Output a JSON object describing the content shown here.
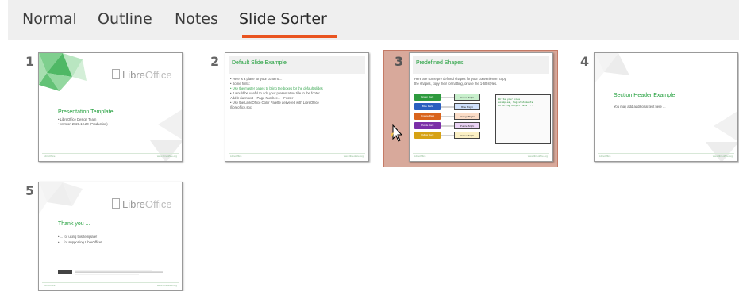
{
  "tabs": [
    {
      "label": "Normal",
      "active": false
    },
    {
      "label": "Outline",
      "active": false
    },
    {
      "label": "Notes",
      "active": false
    },
    {
      "label": "Slide Sorter",
      "active": true
    }
  ],
  "colors": {
    "accent": "#e95420",
    "selection": "#d8a99b",
    "title_green": "#1f9e3a"
  },
  "slides": {
    "s1": {
      "number": "1",
      "logo_main": "Libre",
      "logo_sub": "Office",
      "title": "Presentation Template",
      "bullets": [
        "• LibreOffice Design Team",
        "• Version 2021.10.20 (Production)"
      ],
      "footer_left": "LibreOffice",
      "footer_right": "www.libreoffice.org"
    },
    "s2": {
      "number": "2",
      "title": "Default Slide Example",
      "bullets": [
        "• Here is a place for your content ...",
        "• Some hints:",
        "   • Use the master pages to bring the boxes for the default slides",
        "   • It would be useful to add your presentation title to the footer.",
        "     Add it via  Insert – Page Number... – Footer",
        "   • Use the LibreOffice Color Palette delivered with LibreOffice",
        "     (libreoffice.soc)"
      ],
      "footer_left": "LibreOffice",
      "footer_right": "www.libreoffice.org"
    },
    "s3": {
      "number": "3",
      "title": "Predefined Shapes",
      "intro": [
        "Here are some pre defined shapes for your convenience: copy",
        "the shapes, copy their formatting, or use the 1-60 styles."
      ],
      "shapes_dark": [
        "Green Dark",
        "Blue Dark",
        "Orange Dark",
        "Purple Dark",
        "Yellow Dark"
      ],
      "shapes_bright": [
        "Green Bright",
        "Blue Bright",
        "Orange Bright",
        "Purple Bright",
        "Yellow Bright"
      ],
      "code_text": "Write your code\nexamples, log statements\nor bring output here ...",
      "footer_left": "LibreOffice",
      "footer_right": "www.libreoffice.org"
    },
    "s4": {
      "number": "4",
      "title": "Section Header Example",
      "body": "You may add additional text here ...",
      "footer_left": "LibreOffice",
      "footer_right": "www.libreoffice.org"
    },
    "s5": {
      "number": "5",
      "logo_main": "Libre",
      "logo_sub": "Office",
      "title": "Thank you ...",
      "bullets": [
        "• ... for using this template!",
        "• ... for supporting LibreOffice!"
      ],
      "footer_left": "LibreOffice",
      "footer_right": "www.libreoffice.org"
    }
  }
}
